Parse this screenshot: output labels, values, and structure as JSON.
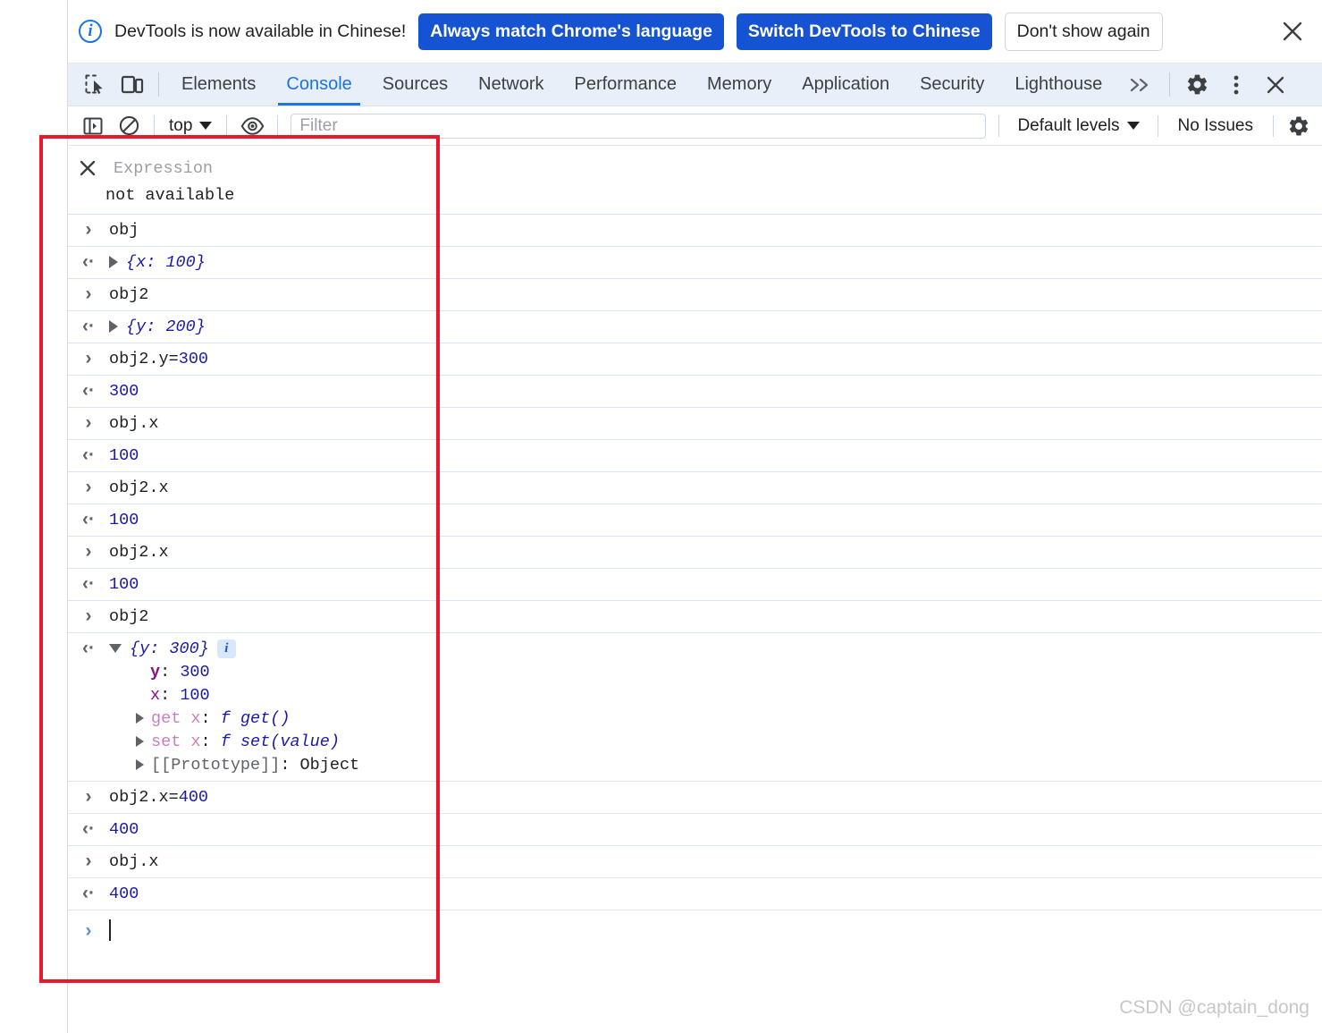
{
  "banner": {
    "icon": "info-circle-icon",
    "message": "DevTools is now available in Chinese!",
    "primary_button": "Always match Chrome's language",
    "secondary_button": "Switch DevTools to Chinese",
    "dismiss_button": "Don't show again",
    "close_icon": "close-icon",
    "primary_color": "#1553d2"
  },
  "tabbar": {
    "inspect_icon": "inspect-element-icon",
    "device_icon": "device-toolbar-icon",
    "tabs": [
      {
        "label": "Elements",
        "active": false
      },
      {
        "label": "Console",
        "active": true
      },
      {
        "label": "Sources",
        "active": false
      },
      {
        "label": "Network",
        "active": false
      },
      {
        "label": "Performance",
        "active": false
      },
      {
        "label": "Memory",
        "active": false
      },
      {
        "label": "Application",
        "active": false
      },
      {
        "label": "Security",
        "active": false
      },
      {
        "label": "Lighthouse",
        "active": false
      }
    ],
    "more_tabs_icon": "chevron-double-right-icon",
    "settings_icon": "gear-icon",
    "menu_icon": "more-vertical-icon",
    "close_icon": "close-icon",
    "active_color": "#1a73e8",
    "background": "#e9eff8"
  },
  "console_toolbar": {
    "sidebar_icon": "console-sidebar-icon",
    "clear_icon": "clear-console-icon",
    "context_label": "top",
    "context_caret": "caret-down-icon",
    "eye_icon": "live-expression-eye-icon",
    "filter_placeholder": "Filter",
    "filter_value": "",
    "levels_label": "Default levels",
    "levels_caret": "caret-down-icon",
    "issues_label": "No Issues",
    "settings_icon": "gear-icon"
  },
  "live_expression": {
    "close_icon": "close-icon",
    "placeholder": "Expression",
    "value": "not available"
  },
  "console_rows": [
    {
      "kind": "input",
      "text": "obj"
    },
    {
      "kind": "output",
      "disclosure": "closed",
      "preview": "{x: 100}"
    },
    {
      "kind": "input",
      "text": "obj2"
    },
    {
      "kind": "output",
      "disclosure": "closed",
      "preview": "{y: 200}"
    },
    {
      "kind": "input",
      "text": "obj2.y=",
      "number": "300"
    },
    {
      "kind": "output",
      "number": "300"
    },
    {
      "kind": "input",
      "text": "obj.x"
    },
    {
      "kind": "output",
      "number": "100"
    },
    {
      "kind": "input",
      "text": "obj2.x"
    },
    {
      "kind": "output",
      "number": "100"
    },
    {
      "kind": "input",
      "text": "obj2.x"
    },
    {
      "kind": "output",
      "number": "100"
    },
    {
      "kind": "input",
      "text": "obj2"
    },
    {
      "kind": "output-expanded",
      "disclosure": "open",
      "preview": "{y: 300}",
      "badge": "i",
      "properties": [
        {
          "key": "y",
          "sep": ": ",
          "value": "300",
          "type": "own-number",
          "bold_key": true
        },
        {
          "key": "x",
          "sep": ": ",
          "value": "100",
          "type": "own-number",
          "bold_key": false
        },
        {
          "key": "get x",
          "sep": ": ",
          "value": "f get()",
          "type": "accessor",
          "disclosure": "closed"
        },
        {
          "key": "set x",
          "sep": ": ",
          "value": "f set(value)",
          "type": "accessor",
          "disclosure": "closed"
        },
        {
          "key": "[[Prototype]]",
          "sep": ": ",
          "value": "Object",
          "type": "prototype",
          "disclosure": "closed"
        }
      ]
    },
    {
      "kind": "input",
      "text": "obj2.x=",
      "number": "400"
    },
    {
      "kind": "output",
      "number": "400"
    },
    {
      "kind": "input",
      "text": "obj.x"
    },
    {
      "kind": "output",
      "number": "400"
    },
    {
      "kind": "prompt",
      "text": ""
    }
  ],
  "annotation": {
    "shape": "red-rectangle-highlight",
    "color": "#e8192c"
  },
  "watermark": {
    "text": "CSDN @captain_dong"
  }
}
